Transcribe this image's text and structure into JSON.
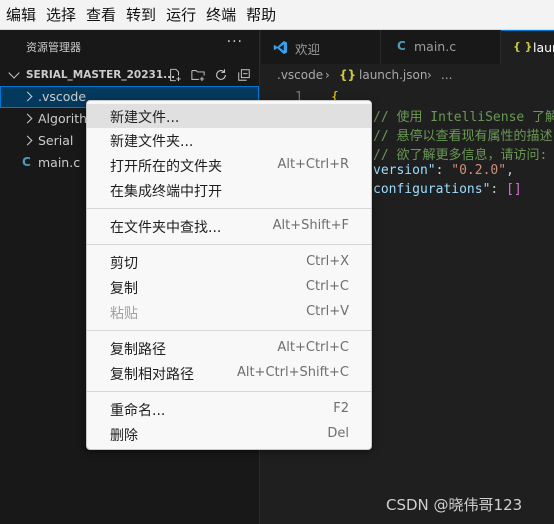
{
  "menubar": {
    "items": [
      "编辑",
      "选择",
      "查看",
      "转到",
      "运行",
      "终端",
      "帮助"
    ]
  },
  "sidebar": {
    "title": "资源管理器",
    "more": "···",
    "folder": "SERIAL_MASTER_20231...",
    "tree": [
      {
        "label": ".vscode",
        "kind": "folder"
      },
      {
        "label": "Algorith",
        "kind": "folder"
      },
      {
        "label": "Serial",
        "kind": "folder"
      },
      {
        "label": "main.c",
        "kind": "file",
        "icon_text": "C"
      }
    ]
  },
  "tabs": [
    {
      "label": "欢迎",
      "icon": "vscode-logo-icon"
    },
    {
      "label": "main.c",
      "icon_text": "C"
    },
    {
      "label": "launc",
      "icon_text": "{ }"
    }
  ],
  "breadcrumb": {
    "folder": ".vscode",
    "sep": "›",
    "icon_text": "{}",
    "file": "launch.json",
    "more": "..."
  },
  "editor": {
    "line_number": "1",
    "brace": "{",
    "comment1": "// 使用 IntelliSense 了解",
    "comment2": "// 悬停以查看现有属性的描述",
    "comment3": "// 欲了解更多信息，请访问:",
    "version_key": "version\"",
    "version_colon": ": ",
    "version_value": "\"0.2.0\"",
    "version_comma": ",",
    "config_key": "configurations\"",
    "config_colon": ": ",
    "config_value": "[]"
  },
  "context_menu": {
    "groups": [
      [
        {
          "label": "新建文件...",
          "shortcut": ""
        },
        {
          "label": "新建文件夹...",
          "shortcut": ""
        },
        {
          "label": "打开所在的文件夹",
          "shortcut": "Alt+Ctrl+R"
        },
        {
          "label": "在集成终端中打开",
          "shortcut": ""
        }
      ],
      [
        {
          "label": "在文件夹中查找...",
          "shortcut": "Alt+Shift+F"
        }
      ],
      [
        {
          "label": "剪切",
          "shortcut": "Ctrl+X"
        },
        {
          "label": "复制",
          "shortcut": "Ctrl+C"
        },
        {
          "label": "粘贴",
          "shortcut": "Ctrl+V",
          "disabled": true
        }
      ],
      [
        {
          "label": "复制路径",
          "shortcut": "Alt+Ctrl+C"
        },
        {
          "label": "复制相对路径",
          "shortcut": "Alt+Ctrl+Shift+C"
        }
      ],
      [
        {
          "label": "重命名...",
          "shortcut": "F2"
        },
        {
          "label": "删除",
          "shortcut": "Del"
        }
      ]
    ]
  },
  "watermark": "CSDN @晓伟哥123",
  "colors": {
    "accent": "#0078d4",
    "selection": "#04395e",
    "comment": "#6a9955",
    "string": "#ce9178",
    "key": "#9cdcfe",
    "bracket": "#ffd700",
    "bracket2": "#da70d6"
  }
}
